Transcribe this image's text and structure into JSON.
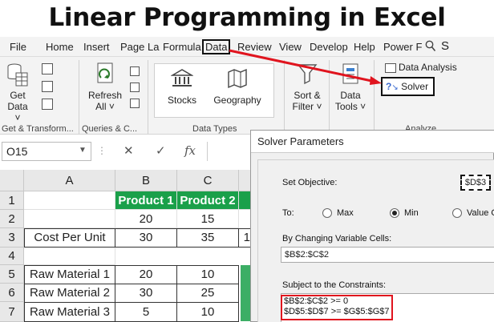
{
  "page_title": "Linear Programming in Excel",
  "ribbon_tabs": [
    "File",
    "Home",
    "Insert",
    "Page La",
    "Formula",
    "Data",
    "Review",
    "View",
    "Develop",
    "Help",
    "Power F"
  ],
  "tell_me": "S",
  "ribbon": {
    "get_data": [
      "Get",
      "Data ˅"
    ],
    "refresh": [
      "Refresh",
      "All ˅"
    ],
    "stocks": "Stocks",
    "geography": "Geography",
    "sort": [
      "Sort &",
      "Filter ˅"
    ],
    "data_tools": [
      "Data",
      "Tools ˅"
    ],
    "data_analysis": "Data Analysis",
    "solver": "Solver",
    "groups": {
      "get_transform": "Get & Transform...",
      "queries": "Queries & C...",
      "data_types": "Data Types",
      "analyze": "Analyze"
    }
  },
  "formula_bar": {
    "name_box": "O15",
    "cancel": "✕",
    "enter": "✓",
    "fx": "fx"
  },
  "sheet": {
    "columns": [
      "A",
      "B",
      "C"
    ],
    "rows": [
      "1",
      "2",
      "3",
      "4",
      "5",
      "6",
      "7"
    ],
    "cells": {
      "B1": "Product 1",
      "C1": "Product 2",
      "B2": "20",
      "C2": "15",
      "A3": "Cost Per Unit",
      "B3": "30",
      "C3": "35",
      "D3": "1",
      "A5": "Raw Material 1",
      "B5": "20",
      "C5": "10",
      "A6": "Raw Material 2",
      "B6": "30",
      "C6": "25",
      "A7": "Raw Material 3",
      "B7": "5",
      "C7": "10"
    }
  },
  "solver_dialog": {
    "title": "Solver Parameters",
    "set_objective_label": "Set Objective:",
    "objective_cell": "$D$3",
    "to_label": "To:",
    "options": [
      "Max",
      "Min",
      "Value O"
    ],
    "selected_option": "Min",
    "changing_label": "By Changing Variable Cells:",
    "changing_value": "$B$2:$C$2",
    "constraints_label": "Subject to the Constraints:",
    "constraints": [
      "$B$2:$C$2 >= 0",
      "$D$5:$D$7 >= $G$5:$G$7"
    ]
  },
  "colors": {
    "header_green": "#1aa04a",
    "annotation_red": "#e0141e",
    "ribbon_bg": "#f3f3f3"
  }
}
